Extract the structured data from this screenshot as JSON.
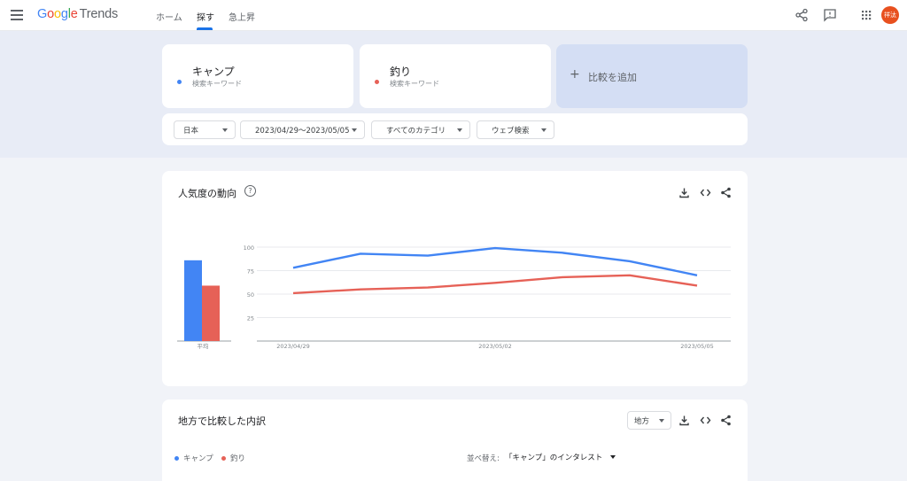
{
  "header": {
    "logo_google": "Google",
    "logo_trends": "Trends",
    "tabs": [
      {
        "label": "ホーム",
        "active": false
      },
      {
        "label": "探す",
        "active": true
      },
      {
        "label": "急上昇",
        "active": false
      }
    ],
    "avatar_text": "祥汰",
    "icons": [
      "menu-icon",
      "share-icon",
      "feedback-icon",
      "apps-grid-icon"
    ]
  },
  "terms": [
    {
      "term": "キャンプ",
      "subtitle": "検索キーワード",
      "color": "#4285f4"
    },
    {
      "term": "釣り",
      "subtitle": "検索キーワード",
      "color": "#e66157"
    }
  ],
  "add_compare": {
    "label": "比較を追加"
  },
  "filters": {
    "region": "日本",
    "date_range": "2023/04/29〜2023/05/05",
    "category": "すべてのカテゴリ",
    "search_type": "ウェブ検索"
  },
  "interest_over_time": {
    "title": "人気度の動向",
    "help_glyph": "?",
    "average_label": "平均"
  },
  "chart_data": {
    "type": "line",
    "x": [
      "2023/04/29",
      "2023/04/30",
      "2023/05/01",
      "2023/05/02",
      "2023/05/03",
      "2023/05/04",
      "2023/05/05"
    ],
    "x_tick_labels": [
      "2023/04/29",
      "2023/05/02",
      "2023/05/05"
    ],
    "y_ticks": [
      "100",
      "75",
      "50",
      "25"
    ],
    "ylim": [
      0,
      100
    ],
    "series": [
      {
        "name": "キャンプ",
        "color": "#4285f4",
        "values": [
          78,
          93,
          91,
          99,
          94,
          85,
          70
        ],
        "average": 86
      },
      {
        "name": "釣り",
        "color": "#e66157",
        "values": [
          51,
          55,
          57,
          62,
          68,
          70,
          59
        ],
        "average": 59
      }
    ],
    "grid": true
  },
  "regional": {
    "title": "地方で比較した内訳",
    "resolution": "地方",
    "legend": [
      "キャンプ",
      "釣り"
    ],
    "sort_label": "並べ替え:",
    "sort_value": "「キャンプ」のインタレスト"
  }
}
